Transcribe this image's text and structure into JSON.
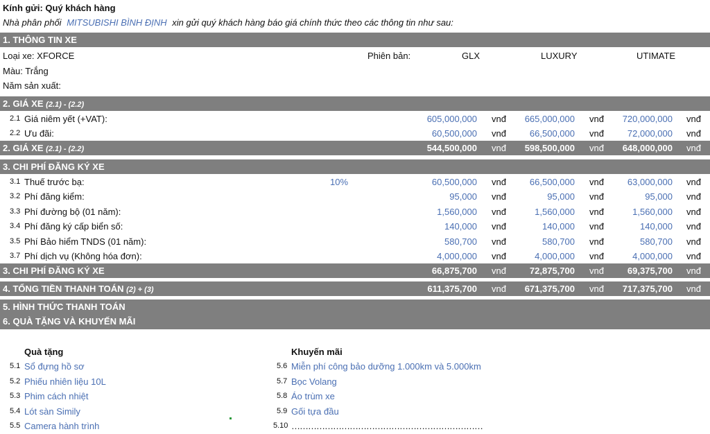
{
  "header": {
    "greeting": "Kính gửi: Quý khách hàng",
    "intro_prefix": "Nhà phân phối",
    "dealer": "MITSUBISHI BÌNH ĐỊNH",
    "intro_suffix": "xin gửi quý khách hàng báo giá chính thức theo các thông tin như sau:"
  },
  "section1": {
    "title": "1. THÔNG TIN XE",
    "car_type": "Loại xe: XFORCE",
    "version_label": "Phiên bản:",
    "versions": [
      "GLX",
      "LUXURY",
      "UTIMATE"
    ],
    "color": "Màu: Trắng",
    "year": "Năm sản xuất:"
  },
  "section2": {
    "title": "2. GIÁ XE",
    "sub": "(2.1) - (2.2)",
    "rows": [
      {
        "idx": "2.1",
        "label": "Giá niêm yết (+VAT):",
        "values": [
          "605,000,000",
          "665,000,000",
          "720,000,000"
        ]
      },
      {
        "idx": "2.2",
        "label": "Ưu đãi:",
        "values": [
          "60,500,000",
          "66,500,000",
          "72,000,000"
        ]
      }
    ],
    "total_title": "2. GIÁ XE",
    "total_sub": "(2.1) - (2.2)",
    "totals": [
      "544,500,000",
      "598,500,000",
      "648,000,000"
    ]
  },
  "section3": {
    "title": "3. CHI PHÍ ĐĂNG KÝ XE",
    "tax_rate": "10%",
    "rows": [
      {
        "idx": "3.1",
        "label": "Thuế trước bạ:",
        "values": [
          "60,500,000",
          "66,500,000",
          "63,000,000"
        ]
      },
      {
        "idx": "3.2",
        "label": "Phí đăng kiểm:",
        "values": [
          "95,000",
          "95,000",
          "95,000"
        ]
      },
      {
        "idx": "3.3",
        "label": "Phí đường bộ (01 năm):",
        "values": [
          "1,560,000",
          "1,560,000",
          "1,560,000"
        ]
      },
      {
        "idx": "3.4",
        "label": "Phí đăng ký cấp biển số:",
        "values": [
          "140,000",
          "140,000",
          "140,000"
        ]
      },
      {
        "idx": "3.5",
        "label": "Phí Bảo hiểm TNDS (01 năm):",
        "values": [
          "580,700",
          "580,700",
          "580,700"
        ]
      },
      {
        "idx": "3.7",
        "label": "Phí dịch vụ (Không hóa đơn):",
        "values": [
          "4,000,000",
          "4,000,000",
          "4,000,000"
        ]
      }
    ],
    "total_title": "3. CHI PHÍ ĐĂNG KÝ XE",
    "totals": [
      "66,875,700",
      "72,875,700",
      "69,375,700"
    ]
  },
  "section4": {
    "title": "4. TỔNG TIỀN THANH TOÁN",
    "sub": "(2) + (3)",
    "totals": [
      "611,375,700",
      "671,375,700",
      "717,375,700"
    ]
  },
  "unit": "vnđ",
  "section5": {
    "title": "5. HÌNH THỨC THANH TOÁN"
  },
  "section6": {
    "title": "6. QUÀ TẶNG VÀ KHUYẾN MÃI",
    "gifts_heading": "Quà tặng",
    "promos_heading": "Khuyến mãi",
    "gifts": [
      {
        "idx": "5.1",
        "label": "Sổ đựng hồ sơ"
      },
      {
        "idx": "5.2",
        "label": "Phiếu nhiên liệu 10L"
      },
      {
        "idx": "5.3",
        "label": "Phim cách nhiệt"
      },
      {
        "idx": "5.4",
        "label": "Lót sàn Simily"
      },
      {
        "idx": "5.5",
        "label": "Camera hành trình"
      }
    ],
    "promos": [
      {
        "idx": "5.6",
        "label": "Miễn phí công bảo dưỡng 1.000km và 5.000km"
      },
      {
        "idx": "5.7",
        "label": "Bọc Volang"
      },
      {
        "idx": "5.8",
        "label": "Áo trùm xe"
      },
      {
        "idx": "5.9",
        "label": "Gối tựa đầu"
      },
      {
        "idx": "5.10",
        "label": "……………………………………………………………"
      }
    ]
  }
}
